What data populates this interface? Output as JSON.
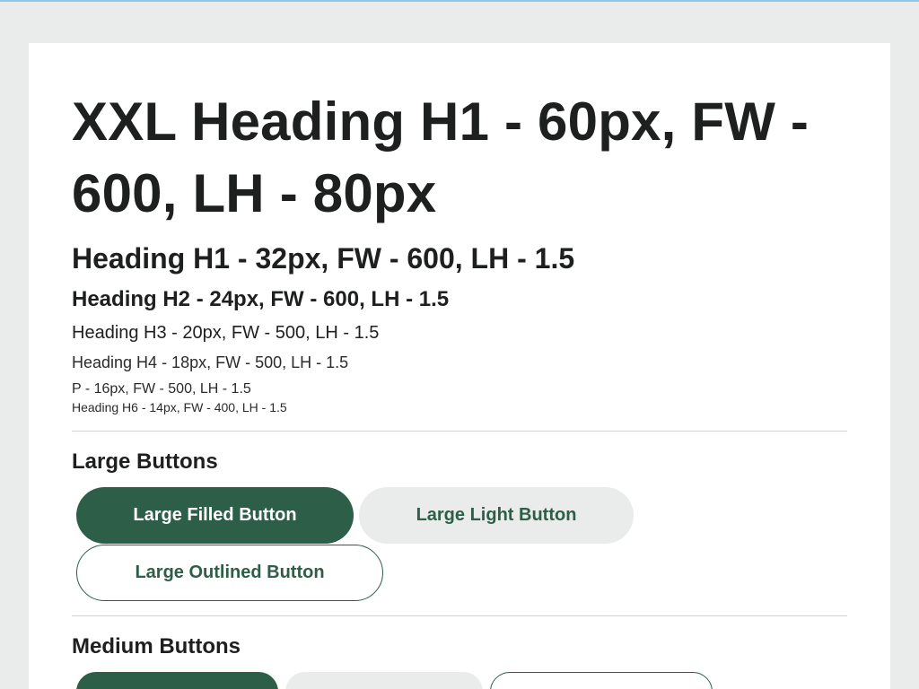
{
  "typography": {
    "xxl": "XXL Heading H1 - 60px, FW - 600, LH - 80px",
    "h1": "Heading H1 - 32px, FW - 600, LH - 1.5",
    "h2": "Heading H2 - 24px, FW - 600, LH - 1.5",
    "h3": "Heading H3 - 20px, FW - 500, LH - 1.5",
    "h4": "Heading H4 - 18px, FW - 500, LH - 1.5",
    "p": "P - 16px, FW - 500, LH - 1.5",
    "h6": "Heading H6 - 14px, FW - 400, LH - 1.5"
  },
  "large_buttons": {
    "title": "Large Buttons",
    "filled_label": "Large Filled Button",
    "light_label": "Large Light Button",
    "outlined_label": "Large Outlined Button"
  },
  "medium_buttons": {
    "title": "Medium Buttons"
  },
  "colors": {
    "brand": "#2d5e47",
    "light_bg": "#e9eceb",
    "page_bg": "#e9eceb",
    "card_bg": "#ffffff",
    "text": "#1e1f1f"
  }
}
